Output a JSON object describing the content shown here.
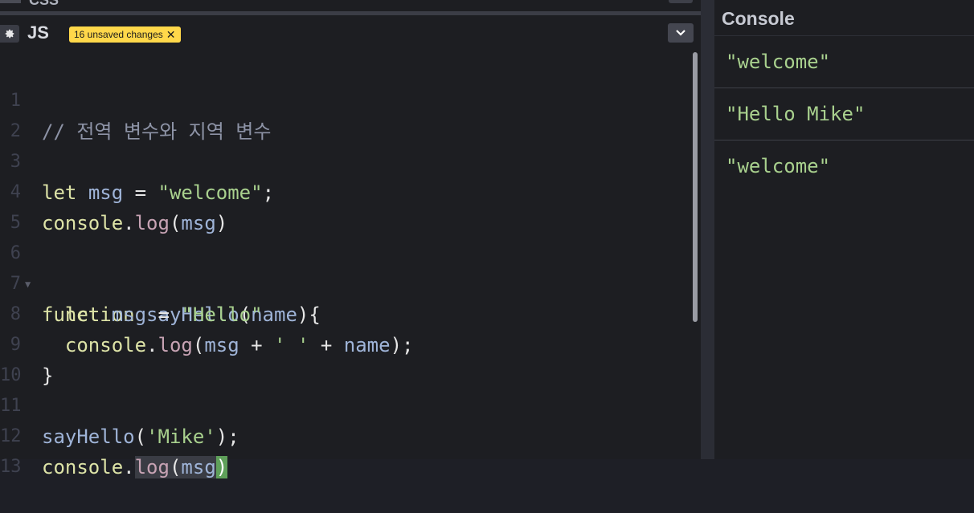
{
  "css_panel": {
    "title": "CSS"
  },
  "js_panel": {
    "title": "JS",
    "unsaved_badge": "16 unsaved changes",
    "badge_close": "✕"
  },
  "code_lines": [
    {
      "num": "1",
      "text": "// 전역 변수와 지역 변수"
    },
    {
      "num": "2",
      "text": ""
    },
    {
      "num": "3",
      "text": "let msg = \"welcome\";"
    },
    {
      "num": "4",
      "text": "console.log(msg)"
    },
    {
      "num": "5",
      "text": ""
    },
    {
      "num": "6",
      "text": "function sayHello(name){"
    },
    {
      "num": "7",
      "text": "  let msg = \"Hello\""
    },
    {
      "num": "8",
      "text": "  console.log(msg + ' ' + name);"
    },
    {
      "num": "9",
      "text": "}"
    },
    {
      "num": "10",
      "text": ""
    },
    {
      "num": "11",
      "text": "sayHello('Mike');"
    },
    {
      "num": "12",
      "text": "console.log(msg)"
    },
    {
      "num": "13",
      "text": ""
    }
  ],
  "tokens": {
    "l1": {
      "comment": "// 전역 변수와 지역 변수"
    },
    "l3": {
      "kw": "let",
      "var": "msg",
      "eq": " = ",
      "str": "\"welcome\"",
      "end": ";"
    },
    "l4": {
      "obj": "console",
      "dot": ".",
      "meth": "log",
      "open": "(",
      "arg": "msg",
      "close": ")"
    },
    "l6": {
      "kw": "function",
      "fn": "sayHello",
      "open": "(",
      "param": "name",
      "close": "){"
    },
    "l7": {
      "kw": "let",
      "var": "msg",
      "eq": " = ",
      "str": "\"Hello\""
    },
    "l8": {
      "obj": "console",
      "dot": ".",
      "meth": "log",
      "open": "(",
      "arg1": "msg",
      "plus1": " + ",
      "str": "' '",
      "plus2": " + ",
      "arg2": "name",
      "close": ");"
    },
    "l9": {
      "brace": "}"
    },
    "l11": {
      "fn": "sayHello",
      "open": "(",
      "str": "'Mike'",
      "close": ");"
    },
    "l12": {
      "obj": "console",
      "dot": ".",
      "meth": "log",
      "open": "(",
      "arg": "msg",
      "close": ")"
    }
  },
  "console": {
    "title": "Console",
    "entries": [
      "\"welcome\"",
      "\"Hello Mike\"",
      "\"welcome\""
    ]
  },
  "colors": {
    "badge_bg": "#ffd84a",
    "string": "#a9d18e",
    "keyword": "#dde3a7",
    "variable": "#9fb4d8",
    "method": "#c7a3b4",
    "cursor_match": "#5fa05a"
  },
  "icons": {
    "settings": "gear-icon",
    "collapse": "chevron-down-icon",
    "badge_close": "close-icon",
    "fold": "fold-arrow-icon"
  }
}
